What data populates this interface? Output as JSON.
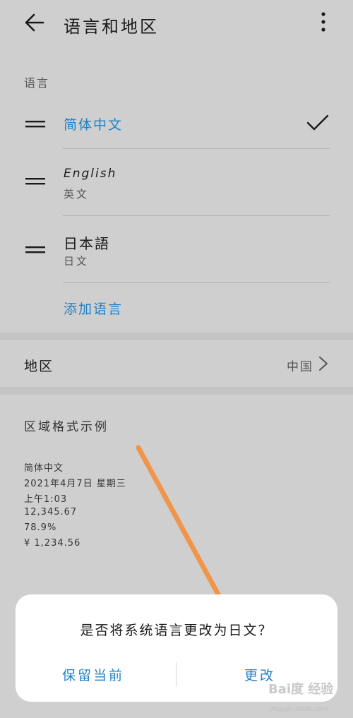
{
  "header": {
    "title": "语言和地区"
  },
  "language_section": {
    "label": "语言",
    "items": [
      {
        "name": "简体中文",
        "subtitle": "",
        "selected": true,
        "color": "#1f82c8"
      },
      {
        "name": "English",
        "subtitle": "英文",
        "selected": false
      },
      {
        "name": "日本語",
        "subtitle": "日文",
        "selected": false
      }
    ],
    "add_label": "添加语言"
  },
  "region": {
    "label": "地区",
    "value": "中国"
  },
  "format_example": {
    "title": "区域格式示例",
    "lines": [
      "简体中文",
      "2021年4月7日 星期三",
      "上午1:03",
      "12,345.67",
      "78.9%",
      "¥ 1,234.56"
    ]
  },
  "dialog": {
    "message": "是否将系统语言更改为日文？",
    "keep_label": "保留当前",
    "change_label": "更改"
  },
  "watermark": {
    "brand": "Bai度 经验",
    "url": "jingyan.baidu.com"
  },
  "colors": {
    "accent": "#1f82c8",
    "background": "#cfcfcf",
    "annotation_arrow": "#f0954a"
  },
  "icons": [
    "back-arrow-icon",
    "more-vertical-icon",
    "drag-handle-icon",
    "checkmark-icon",
    "chevron-right-icon"
  ]
}
